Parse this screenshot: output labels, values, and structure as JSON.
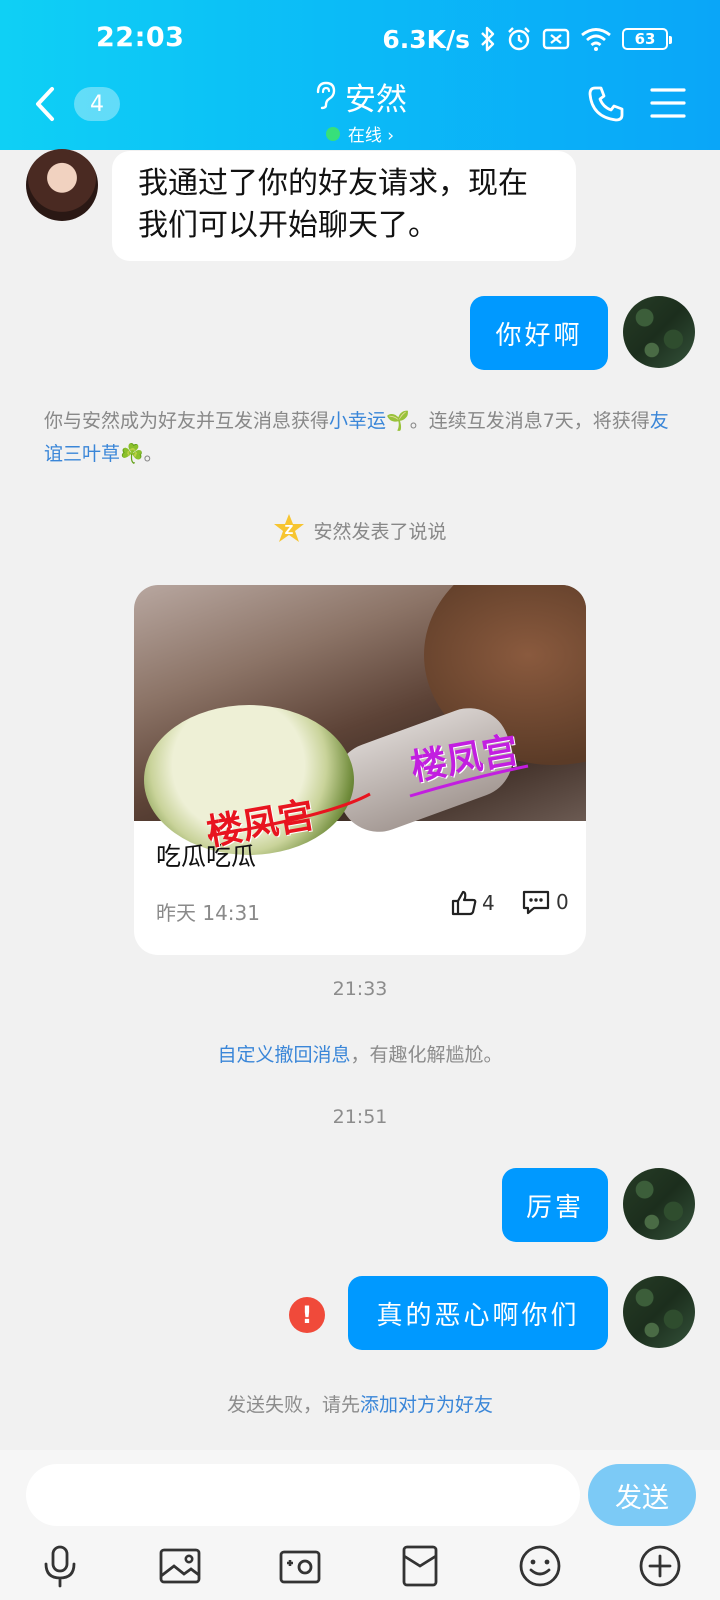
{
  "status_bar": {
    "time": "22:03",
    "net_speed": "6.3K/s",
    "battery": "63",
    "icons": [
      "bluetooth-icon",
      "alarm-icon",
      "no-sim-icon",
      "wifi-icon",
      "battery-icon"
    ]
  },
  "header": {
    "unread_count": "4",
    "contact_name": "安然",
    "status_text": "在线 ›",
    "status_color": "#37e07a",
    "icons": [
      "back-icon",
      "ear-icon",
      "phone-icon",
      "menu-icon"
    ]
  },
  "messages": {
    "friend_accepted": "我通过了你的好友请求，现在我们可以开始聊天了。",
    "hello": "你好啊",
    "luck_note": {
      "part1": "你与安然成为好友并互发消息获得",
      "link1": "小幸运🌱",
      "part2": "。连续互发消息7天，将获得",
      "link2": "友谊三叶草☘️",
      "part3": "。"
    },
    "qzone_notice": "安然发表了说说",
    "qzone_card": {
      "text": "吃瓜吃瓜",
      "time": "昨天 14:31",
      "likes": "4",
      "comments": "0"
    },
    "watermark": "楼凤宫",
    "ts1": "21:33",
    "recall_tip": {
      "link": "自定义撤回消息",
      "rest": "，有趣化解尴尬。"
    },
    "ts2": "21:51",
    "msg_amazing": "厉害",
    "msg_disgusting": "真的恶心啊你们",
    "error_mark": "!",
    "send_fail": {
      "text": "发送失败，请先",
      "link": "添加对方为好友"
    }
  },
  "input_bar": {
    "placeholder": "",
    "send_label": "发送",
    "tools": [
      "mic-icon",
      "image-icon",
      "camera-icon",
      "red-packet-icon",
      "emoji-icon",
      "plus-icon"
    ]
  },
  "colors": {
    "header_start": "#0fd0f5",
    "header_end": "#0aa6f8",
    "bubble_out": "#0099ff",
    "link": "#3a86d8",
    "error": "#f04a3a"
  }
}
